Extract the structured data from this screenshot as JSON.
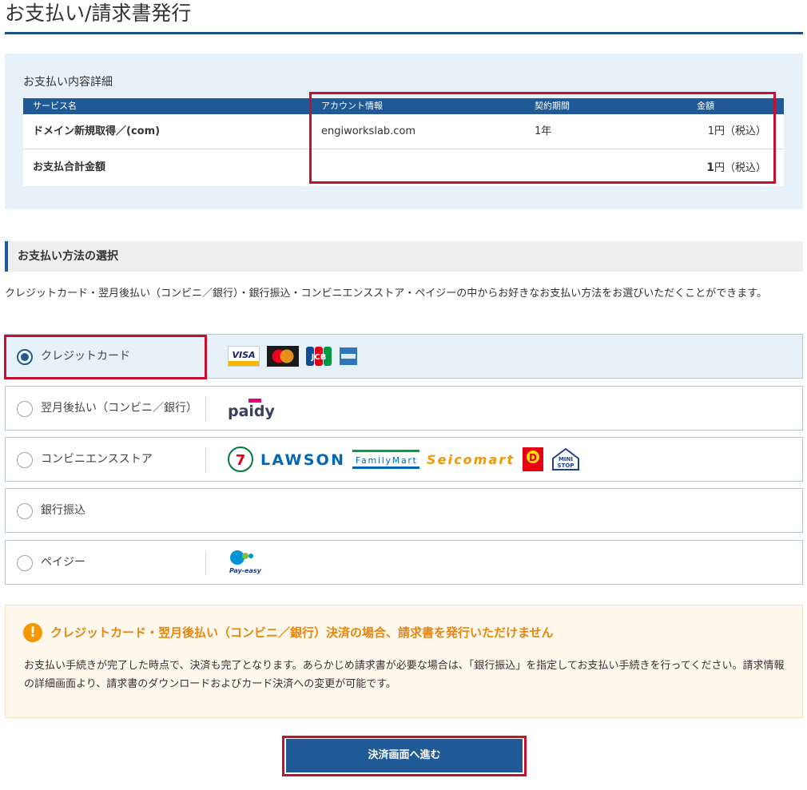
{
  "page": {
    "title": "お支払い/請求書発行"
  },
  "details": {
    "heading": "お支払い内容詳細",
    "headers": [
      "サービス名",
      "アカウント情報",
      "契約期間",
      "金額"
    ],
    "rows": [
      {
        "service": "ドメイン新規取得／(com)",
        "account": "engiworkslab.com",
        "period": "1年",
        "amount": "1",
        "unit": "円（税込）"
      }
    ],
    "total": {
      "label": "お支払合計金額",
      "amount": "1",
      "unit": "円（税込）"
    }
  },
  "methods": {
    "heading": "お支払い方法の選択",
    "intro": "クレジットカード・翌月後払い（コンビニ／銀行）・銀行振込・コンビニエンスストア・ペイジーの中からお好きなお支払い方法をお選びいただくことができます。",
    "options": [
      {
        "label": "クレジットカード",
        "selected": true
      },
      {
        "label": "翌月後払い（コンビニ／銀行）",
        "selected": false
      },
      {
        "label": "コンビニエンスストア",
        "selected": false
      },
      {
        "label": "銀行振込",
        "selected": false
      },
      {
        "label": "ペイジー",
        "selected": false
      }
    ],
    "logos": {
      "visa": "VISA",
      "jcb": "JCB",
      "paidy": "paidy",
      "seven": "7",
      "lawson": "LAWSON",
      "familymart": "FamilyMart",
      "seicomart": "Seicomart",
      "daily": "D",
      "ministop_top": "MINI",
      "ministop_bottom": "STOP",
      "payeasy": "Pay-easy"
    }
  },
  "notice": {
    "title": "クレジットカード・翌月後払い（コンビニ／銀行）決済の場合、請求書を発行いただけません",
    "body": "お支払い手続きが完了した時点で、決済も完了となります。あらかじめ請求書が必要な場合は、「銀行振込」を指定してお支払い手続きを行ってください。請求情報の詳細画面より、請求書のダウンロードおよびカード決済への変更が可能です。"
  },
  "proceed_label": "決済画面へ進む",
  "colors": {
    "brand_blue": "#1f5a96",
    "title_rule": "#1d4f7c",
    "highlight_red": "#c8102e",
    "notice_orange": "#f39800"
  }
}
